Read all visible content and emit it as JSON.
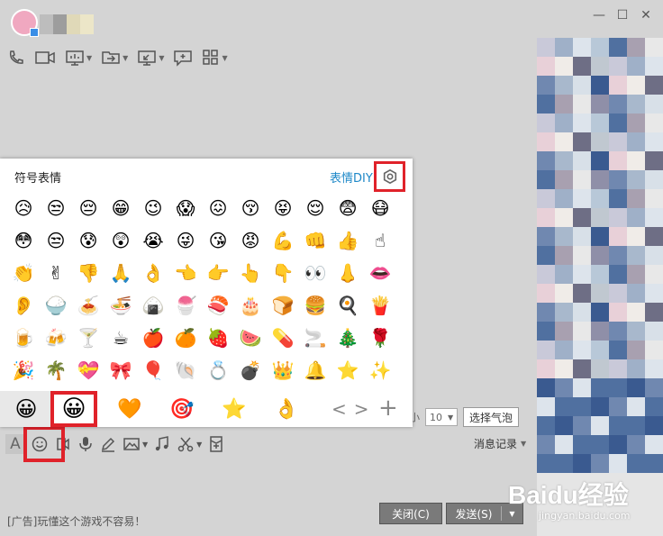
{
  "window": {
    "controls": [
      "—",
      "☐",
      "✕"
    ]
  },
  "toolbar": {
    "items": [
      "phone-icon",
      "video-icon",
      "screen-share-icon",
      "file-transfer-icon",
      "remote-desktop-icon",
      "message-box-icon",
      "apps-icon"
    ]
  },
  "emoji_panel": {
    "title": "符号表情",
    "diy_label": "表情DIY",
    "rows": [
      [
        "😥",
        "😒",
        "😔",
        "😁",
        "😉",
        "😱",
        "😖",
        "😚",
        "😝",
        "😌",
        "😨",
        "😷"
      ],
      [
        "😳",
        "😒",
        "😰",
        "😲",
        "😭",
        "😜",
        "😘",
        "😡",
        "💪",
        "👊",
        "👍",
        "☝"
      ],
      [
        "👏",
        "✌",
        "👎",
        "🙏",
        "👌",
        "👈",
        "👉",
        "👆",
        "👇",
        "👀",
        "👃",
        "👄"
      ],
      [
        "👂",
        "🍚",
        "🍝",
        "🍜",
        "🍙",
        "🍧",
        "🍣",
        "🎂",
        "🍞",
        "🍔",
        "🍳",
        "🍟"
      ],
      [
        "🍺",
        "🍻",
        "🍸",
        "☕",
        "🍎",
        "🍊",
        "🍓",
        "🍉",
        "💊",
        "🚬",
        "🎄",
        "🌹"
      ],
      [
        "🎉",
        "🌴",
        "💝",
        "🎀",
        "🎈",
        "🐚",
        "💍",
        "💣",
        "👑",
        "🔔",
        "⭐",
        "✨"
      ]
    ],
    "tabs": [
      "😀",
      "😀",
      "🧡",
      "🎯",
      "⭐",
      "👌"
    ],
    "nav_prev": "<",
    "nav_next": ">",
    "add": "+"
  },
  "composer": {
    "font_size_label": "小",
    "font_size_value": "10",
    "bubble_button": "选择气泡",
    "msg_log": "消息记录",
    "close_button": "关闭(C)",
    "send_button": "发送(S)",
    "ad_text": "[广告]玩懂这个游戏不容易！"
  },
  "watermark": {
    "text": "Baidu经验",
    "sub": "jingyan.baidu.com"
  },
  "colors": {
    "accent": "#1e88c8",
    "highlight": "#e0222a"
  }
}
